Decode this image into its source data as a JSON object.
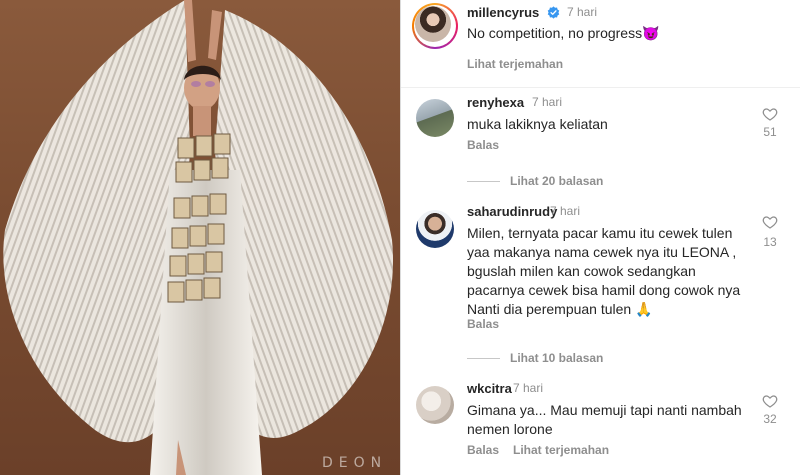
{
  "photo": {
    "watermark": "DEON"
  },
  "caption": {
    "username": "millencyrus",
    "time": "7 hari",
    "text": "No competition, no progress😈",
    "translate": "Lihat terjemahan"
  },
  "comments": [
    {
      "username": "renyhexa",
      "time": "7 hari",
      "text": "muka lakiknya keliatan",
      "likes": "51",
      "reply": "Balas",
      "view_replies": "Lihat 20 balasan"
    },
    {
      "username": "saharudinrudy",
      "time": "7 hari",
      "text": "Milen, ternyata pacar kamu itu cewek tulen yaa makanya nama cewek nya itu LEONA , bguslah milen kan cowok sedangkan pacarnya cewek bisa hamil dong cowok nya Nanti dia perempuan tulen 🙏",
      "likes": "13",
      "reply": "Balas",
      "view_replies": "Lihat 10 balasan"
    },
    {
      "username": "wkcitra",
      "time": "7 hari",
      "text": "Gimana ya... Mau memuji tapi nanti nambah nemen lorone",
      "likes": "32",
      "reply": "Balas",
      "translate": "Lihat terjemahan"
    }
  ],
  "icons": {
    "verified": "verified-badge-icon",
    "heart": "heart-outline-icon"
  },
  "colors": {
    "verified": "#3897f0",
    "muted": "#8e8e8e",
    "text": "#262626"
  }
}
